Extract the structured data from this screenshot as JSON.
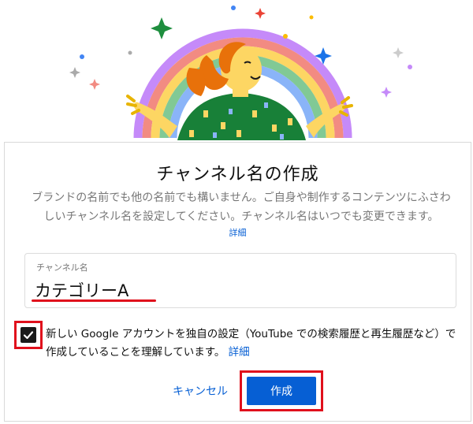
{
  "dialog": {
    "title": "チャンネル名の作成",
    "description": "ブランドの名前でも他の名前でも構いません。ご自身や制作するコンテンツにふさわしいチャンネル名を設定してください。チャンネル名はいつでも変更できます。",
    "details_link": "詳細"
  },
  "channel_field": {
    "label": "チャンネル名",
    "value": "カテゴリーA"
  },
  "consent": {
    "checked": true,
    "text": "新しい Google アカウントを独自の設定（YouTube での検索履歴と再生履歴など）で作成していることを理解しています。",
    "link": "詳細"
  },
  "actions": {
    "cancel_label": "キャンセル",
    "create_label": "作成"
  },
  "colors": {
    "accent": "#065fd4",
    "highlight": "#e0101c"
  },
  "icons": {
    "illustration": "rainbow-person-illustration",
    "checkbox": "check-icon"
  }
}
